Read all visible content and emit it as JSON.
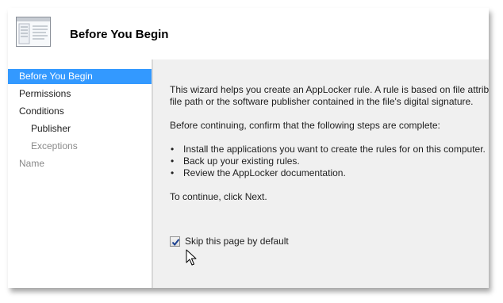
{
  "header": {
    "title": "Before You Begin",
    "icon": "wizard-page-icon"
  },
  "nav": {
    "items": [
      {
        "label": "Before You Begin",
        "state": "selected"
      },
      {
        "label": "Permissions",
        "state": "normal"
      },
      {
        "label": "Conditions",
        "state": "normal"
      },
      {
        "label": "Publisher",
        "state": "normal"
      },
      {
        "label": "Exceptions",
        "state": "disabled"
      },
      {
        "label": "Name",
        "state": "disabled"
      }
    ]
  },
  "content": {
    "intro_line1": "This wizard helps you create an AppLocker rule. A rule is based on file attribu",
    "intro_line2": "file path or the software publisher contained in the file's digital signature.",
    "before_continuing": "Before continuing, confirm that the following steps are complete:",
    "steps": [
      "Install the applications you want to create the rules for on this computer.",
      "Back up your existing rules.",
      "Review the AppLocker documentation."
    ],
    "continue_text": "To continue, click Next."
  },
  "skip_option": {
    "label": "Skip this page by default",
    "checked": true
  },
  "colors": {
    "selection": "#3399ff",
    "panel_background": "#f0f0f0",
    "disabled_text": "#8a8a8a"
  }
}
